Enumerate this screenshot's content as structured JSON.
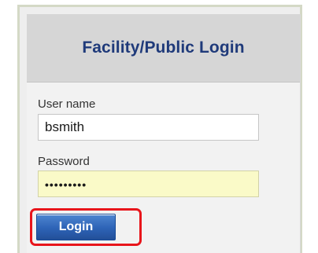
{
  "panel": {
    "title": "Facility/Public Login"
  },
  "username": {
    "label": "User name",
    "value": "bsmith"
  },
  "password": {
    "label": "Password",
    "masked_value": "•••••••••"
  },
  "login": {
    "label": "Login"
  },
  "colors": {
    "title": "#1f3a7a",
    "button": "#2d63b6",
    "highlight": "#e8151b",
    "password_bg": "#fafac8",
    "header_bg": "#d6d6d6"
  }
}
